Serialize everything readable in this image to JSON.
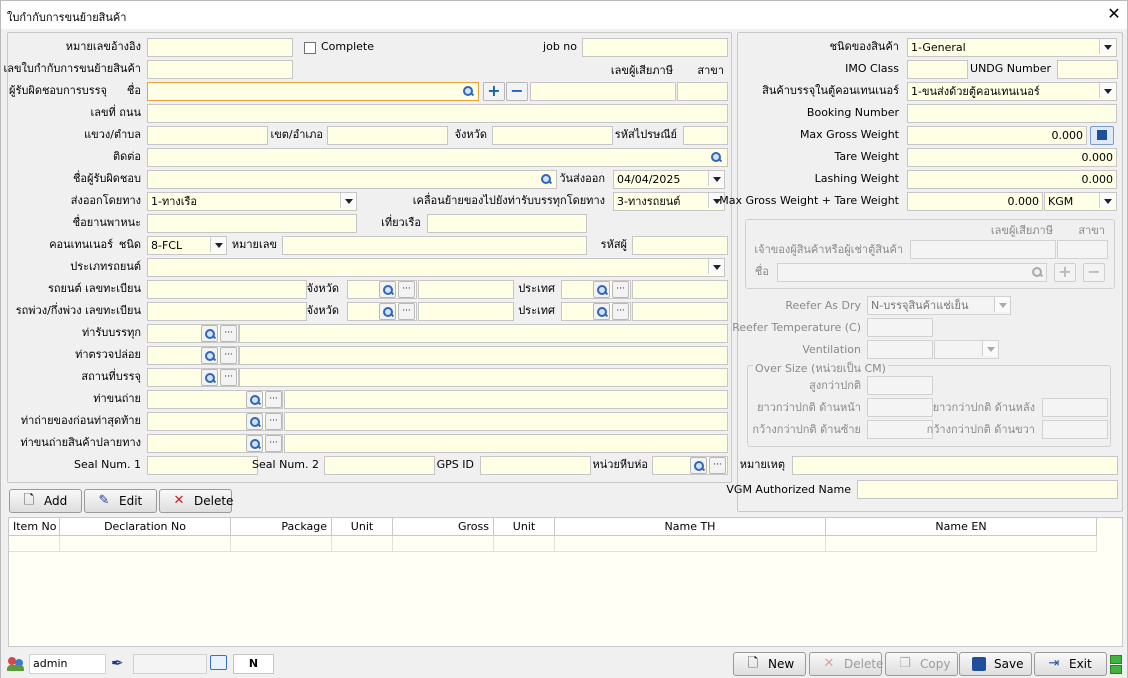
{
  "window": {
    "title": "ใบกำกับการขนย้ายสินค้า"
  },
  "left": {
    "ref_no_label": "หมายเลขอ้างอิง",
    "complete_label": "Complete",
    "job_no_label": "job no",
    "transport_doc_label": "เลขใบกำกับการขนย้ายสินค้า",
    "tax_id_label": "เลขผู้เสียภาษี",
    "branch_label": "สาขา",
    "responsible_label": "ผู้รับผิดชอบการบรรจุ",
    "name_label": "ชื่อ",
    "address_label": "เลขที่ ถนน",
    "subdistrict_label": "แขวง/ตำบล",
    "district_label": "เขต/อำเภอ",
    "province_label": "จังหวัด",
    "postcode_label": "รหัสไปรษณีย์",
    "contact_label": "ติดต่อ",
    "responsible_name_label": "ชื่อผู้รับผิดชอบ",
    "ship_date_label": "วันส่งออก",
    "ship_date_value": "04/04/2025",
    "ship_by_label": "ส่งออกโดยทาง",
    "ship_by_value": "1-ทางเรือ",
    "move_to_port_label": "เคลื่อนย้ายของไปยังท่ารับบรรทุกโดยทาง",
    "move_to_port_value": "3-ทางรถยนต์",
    "vessel_label": "ชื่อยานพาหนะ",
    "voyage_label": "เที่ยวเรือ",
    "container_label": "คอนเทนเนอร์",
    "type_label": "ชนิด",
    "container_type_value": "8-FCL",
    "number_label": "หมายเลข",
    "seal_label": "รหัสผู้",
    "vehicle_type_label": "ประเภทรถยนต์",
    "truck_plate_label": "รถยนต์ เลขทะเบียน",
    "trailer_plate_label": "รถพ่วง/กึ่งพ่วง เลขทะเบียน",
    "country_label": "ประเทศ",
    "loading_port_label": "ท่ารับบรรทุก",
    "inspection_port_label": "ท่าตรวจปล่อย",
    "stuffing_place_label": "สถานที่บรรจุ",
    "transfer_port_label": "ท่าขนถ่าย",
    "last_unload_port_label": "ท่าถ่ายของก่อนท่าสุดท้าย",
    "destination_port_label": "ท่าขนถ่ายสินค้าปลายทาง",
    "seal1_label": "Seal Num. 1",
    "seal2_label": "Seal Num. 2",
    "gps_label": "GPS ID",
    "pkg_unit_label": "หน่วยหีบห่อ"
  },
  "right": {
    "goods_type_label": "ชนิดของสินค้า",
    "goods_type_value": "1-General",
    "imo_label": "IMO Class",
    "undg_label": "UNDG Number",
    "stuffing_label": "สินค้าบรรจุในตู้คอนเทนเนอร์",
    "stuffing_value": "1-ขนส่งด้วยตู้คอนเทนเนอร์",
    "booking_label": "Booking Number",
    "max_gross_label": "Max Gross Weight",
    "max_gross_value": "0.000",
    "tare_label": "Tare Weight",
    "tare_value": "0.000",
    "lashing_label": "Lashing Weight",
    "lashing_value": "0.000",
    "max_tare_label": "Max Gross Weight + Tare Weight",
    "max_tare_value": "0.000",
    "unit_value": "KGM",
    "owner_tax_label": "เลขผู้เสียภาษี",
    "owner_branch_label": "สาขา",
    "owner_label": "เจ้าของผู้สินค้าหรือผู้เช่าตู้สินค้า",
    "owner_name_label": "ชื่อ",
    "reefer_dry_label": "Reefer As Dry",
    "reefer_dry_value": "N-บรรจุสินค้าแช่เย็น",
    "reefer_temp_label": "Reefer Temperature (C)",
    "ventilation_label": "Ventilation",
    "oversize_legend": "Over Size (หน่วยเป็น CM)",
    "over_height_label": "สูงกว่าปกติ",
    "over_front_label": "ยาวกว่าปกติ ด้านหน้า",
    "over_back_label": "ยาวกว่าปกติ ด้านหลัง",
    "over_left_label": "กว้างกว่าปกติ ด้านซ้าย",
    "over_right_label": "กว้างกว่าปกติ ด้านขวา",
    "remark_label": "หมายเหตุ",
    "vgm_label": "VGM Authorized Name"
  },
  "actions": {
    "add": "Add",
    "edit": "Edit",
    "delete": "Delete"
  },
  "grid": {
    "columns": [
      "Item No",
      "Declaration No",
      "Package",
      "Unit",
      "Gross",
      "Unit",
      "Name TH",
      "Name EN"
    ]
  },
  "status": {
    "user": "admin",
    "mode": "N",
    "new": "New",
    "delete": "Delete",
    "copy": "Copy",
    "save": "Save",
    "exit": "Exit"
  }
}
